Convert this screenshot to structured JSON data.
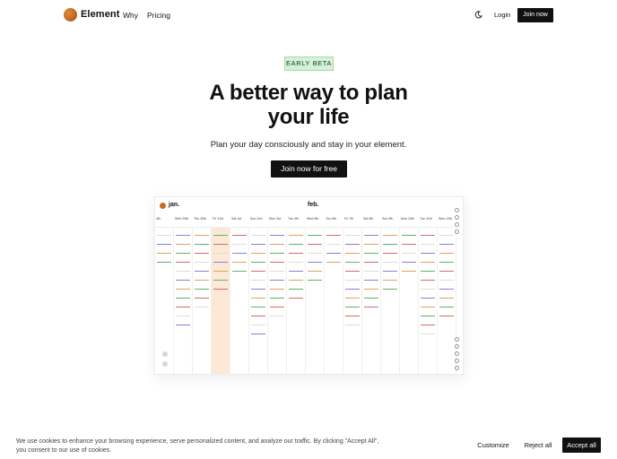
{
  "nav": {
    "brand": "Element",
    "links": [
      "Why",
      "Pricing"
    ],
    "theme_icon": "moon-icon",
    "login": "Login",
    "join": "Join now"
  },
  "hero": {
    "badge": "EARLY BETA",
    "headline_line1": "A better way to plan",
    "headline_line2": "your life",
    "subline": "Plan your day consciously and stay in your element.",
    "cta": "Join now for free"
  },
  "preview": {
    "months": [
      "jan.",
      "feb."
    ],
    "days": [
      "4th",
      "Wed 29th",
      "Thu 30th",
      "Fri 31st",
      "Sat 1st",
      "Sun 2nd",
      "Mon 3rd",
      "Tue 4th",
      "Wed 5th",
      "Thu 6th",
      "Fri 7th",
      "Sat 8th",
      "Sun 9th",
      "Mon 10th",
      "Tue 11th",
      "Wed 12th"
    ]
  },
  "cookie": {
    "text": "We use cookies to enhance your browsing experience, serve personalized content, and analyze our traffic. By clicking \"Accept All\", you consent to our use of cookies.",
    "customize": "Customize",
    "reject": "Reject all",
    "accept": "Accept all"
  },
  "colors": {
    "accent": "#111111",
    "badge_bg": "#d3f2d6",
    "brand_orange": "#c96a24",
    "today_highlight": "#fbe9d5"
  }
}
